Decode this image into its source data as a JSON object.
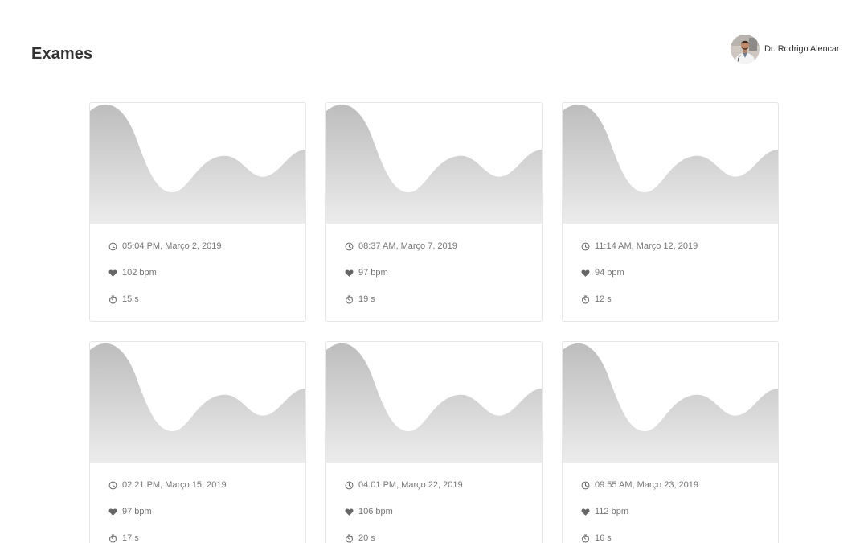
{
  "header": {
    "title": "Exames",
    "user": {
      "name": "Dr. Rodrigo Alencar",
      "avatar_icon": "doctor-avatar"
    }
  },
  "icons": {
    "time": "clock-icon",
    "heart_rate": "heart-icon",
    "duration": "stopwatch-icon"
  },
  "colors": {
    "title": "#333333",
    "meta_text": "#777777",
    "icon": "#666666",
    "wave_top": "#bdbdbd",
    "wave_bottom": "#ececec",
    "card_border": "#e6e6e6"
  },
  "exams": [
    {
      "datetime": "05:04 PM, Março 2, 2019",
      "bpm": "102 bpm",
      "duration": "15 s"
    },
    {
      "datetime": "08:37 AM, Março 7, 2019",
      "bpm": "97 bpm",
      "duration": "19 s"
    },
    {
      "datetime": "11:14 AM, Março 12, 2019",
      "bpm": "94 bpm",
      "duration": "12 s"
    },
    {
      "datetime": "02:21 PM, Março 15, 2019",
      "bpm": "97 bpm",
      "duration": "17 s"
    },
    {
      "datetime": "04:01 PM, Março 22, 2019",
      "bpm": "106 bpm",
      "duration": "20 s"
    },
    {
      "datetime": "09:55 AM, Março 23, 2019",
      "bpm": "112 bpm",
      "duration": "16 s"
    }
  ]
}
